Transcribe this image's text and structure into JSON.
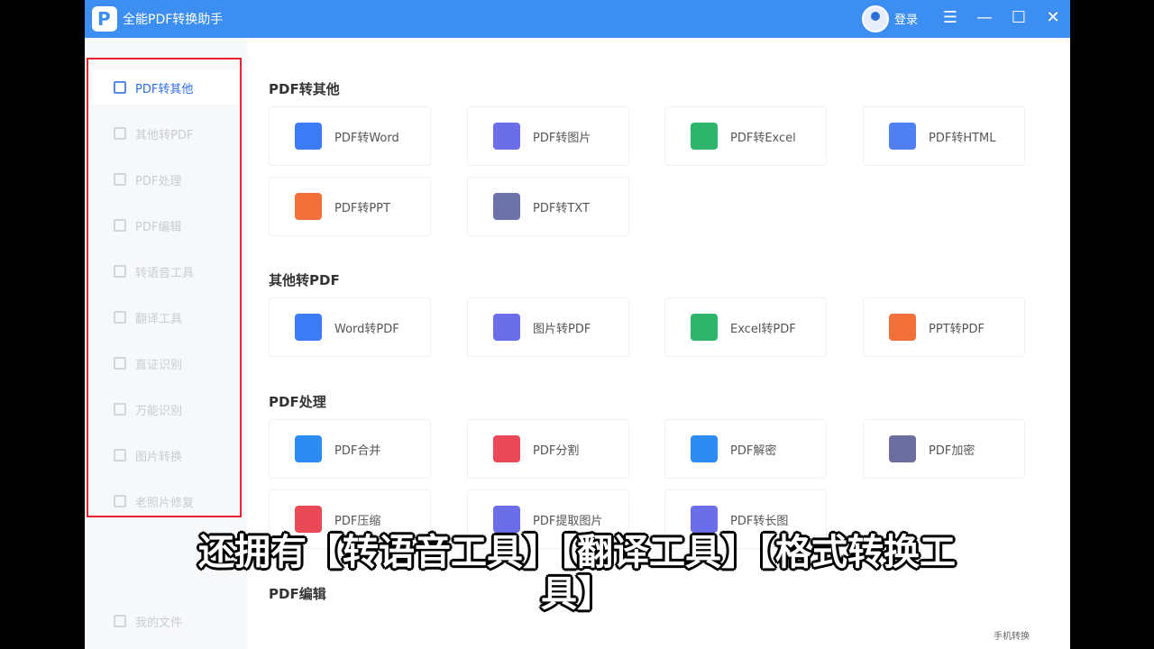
{
  "titlebar": {
    "app_title": "全能PDF转换助手",
    "logo_letter": "P",
    "login": "登录",
    "menu_icon": "☰",
    "min_icon": "—",
    "max_icon": "☐",
    "close_icon": "✕"
  },
  "sidebar": {
    "items": [
      {
        "label": "PDF转其他",
        "active": true
      },
      {
        "label": "其他转PDF"
      },
      {
        "label": "PDF处理"
      },
      {
        "label": "PDF编辑"
      },
      {
        "label": "转语音工具"
      },
      {
        "label": "翻译工具"
      },
      {
        "label": "直证识别"
      },
      {
        "label": "万能识别"
      },
      {
        "label": "图片转换"
      },
      {
        "label": "老照片修复"
      }
    ],
    "bottom_item": "我的文件"
  },
  "sections": [
    {
      "title": "PDF转其他",
      "cards": [
        {
          "label": "PDF转Word",
          "color": "#3b7cf6"
        },
        {
          "label": "PDF转图片",
          "color": "#6b6ee8"
        },
        {
          "label": "PDF转Excel",
          "color": "#2db56b"
        },
        {
          "label": "PDF转HTML",
          "color": "#4f7ff0"
        },
        {
          "label": "PDF转PPT",
          "color": "#f2703a"
        },
        {
          "label": "PDF转TXT",
          "color": "#6d72a8"
        }
      ]
    },
    {
      "title": "其他转PDF",
      "cards": [
        {
          "label": "Word转PDF",
          "color": "#3b7cf6"
        },
        {
          "label": "图片转PDF",
          "color": "#6b6ee8"
        },
        {
          "label": "Excel转PDF",
          "color": "#2db56b"
        },
        {
          "label": "PPT转PDF",
          "color": "#f2703a"
        }
      ]
    },
    {
      "title": "PDF处理",
      "cards": [
        {
          "label": "PDF合并",
          "color": "#2c8cf4"
        },
        {
          "label": "PDF分割",
          "color": "#ea4a57"
        },
        {
          "label": "PDF解密",
          "color": "#2c8cf4"
        },
        {
          "label": "PDF加密",
          "color": "#6b6e9e"
        },
        {
          "label": "PDF压缩",
          "color": "#ea4a57"
        },
        {
          "label": "PDF提取图片",
          "color": "#6b6ee8"
        },
        {
          "label": "PDF转长图",
          "color": "#6b6ee8"
        }
      ]
    },
    {
      "title": "PDF编辑",
      "cards": []
    }
  ],
  "subtitle_line1": "还拥有【转语音工具】【翻译工具】【格式转换工",
  "subtitle_line2": "具】",
  "phone_tag": "手机转换"
}
